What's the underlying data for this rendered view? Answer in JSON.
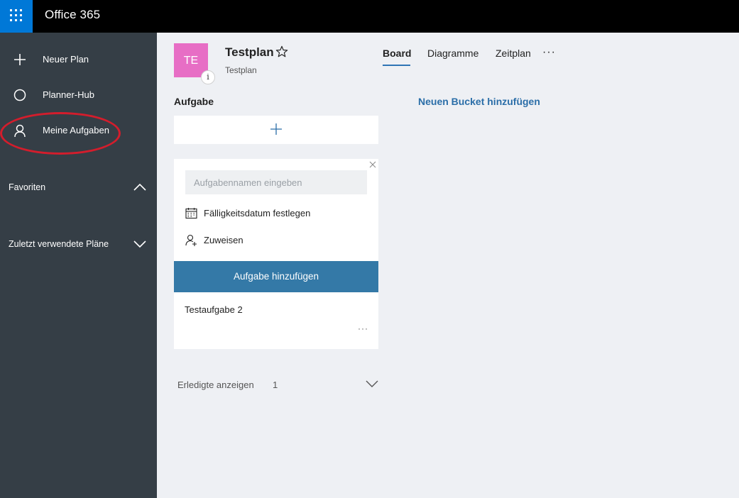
{
  "topbar": {
    "app_launcher_icon": "waffle-grid-icon",
    "brand": "Office 365",
    "brand_color": "#0078d7"
  },
  "sidebar": {
    "items": [
      {
        "label": "Neuer Plan",
        "icon": "plus-icon"
      },
      {
        "label": "Planner-Hub",
        "icon": "circle-icon"
      },
      {
        "label": "Meine Aufgaben",
        "icon": "person-icon",
        "highlighted": true
      }
    ],
    "sections": [
      {
        "label": "Favoriten",
        "state": "expanded",
        "icon": "chevron-up-icon"
      },
      {
        "label": "Zuletzt verwendete Pläne",
        "state": "collapsed",
        "icon": "chevron-down-icon"
      }
    ],
    "background": "#353e46",
    "highlight_color": "#d31d2c"
  },
  "plan": {
    "avatar_initials": "TE",
    "avatar_color": "#e76ec5",
    "info_glyph": "i",
    "title": "Testplan",
    "subtitle": "Testplan"
  },
  "tabs": [
    {
      "label": "Board",
      "active": true
    },
    {
      "label": "Diagramme",
      "active": false
    },
    {
      "label": "Zeitplan",
      "active": false
    }
  ],
  "more_menu_glyph": "···",
  "board": {
    "bucket_name": "Aufgabe",
    "add_bucket_label": "Neuen Bucket hinzufügen",
    "new_task": {
      "placeholder": "Aufgabennamen eingeben",
      "value": "",
      "due_date_label": "Fälligkeitsdatum festlegen",
      "assign_label": "Zuweisen",
      "submit_label": "Aufgabe hinzufügen",
      "submit_color": "#3479a7"
    },
    "tasks": [
      {
        "title": "Testaufgabe 2",
        "more_glyph": "···"
      }
    ],
    "completed": {
      "label": "Erledigte anzeigen",
      "count": "1"
    }
  }
}
